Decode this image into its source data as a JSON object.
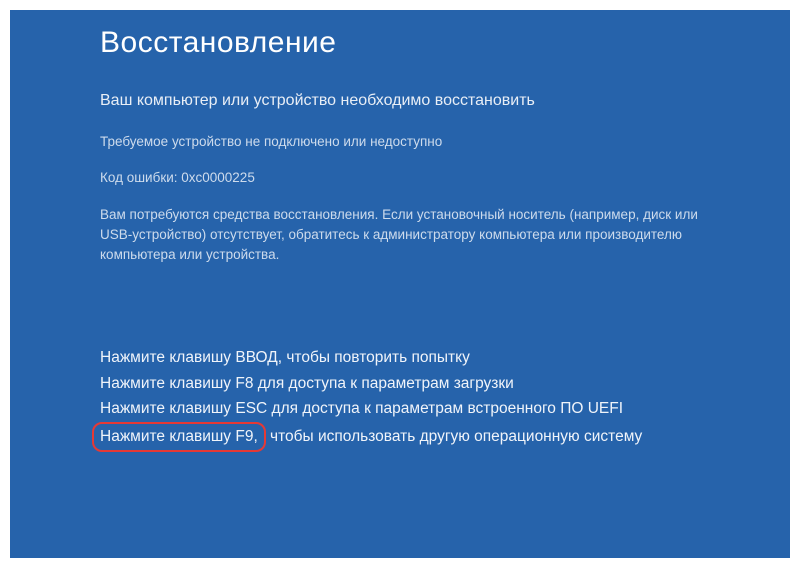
{
  "title": "Восстановление",
  "subtitle": "Ваш компьютер или устройство необходимо восстановить",
  "details": {
    "line1": "Требуемое устройство не подключено или недоступно",
    "line2": "Код ошибки: 0xc0000225",
    "line3": "Вам потребуются средства восстановления. Если установочный носитель (например, диск или USB-устройство) отсутствует, обратитесь к администратору компьютера или производителю компьютера или устройства."
  },
  "actions": {
    "enter": "Нажмите клавишу ВВОД, чтобы повторить попытку",
    "f8": "Нажмите клавишу F8 для доступа к параметрам загрузки",
    "esc": "Нажмите клавишу ESC для доступа к параметрам встроенного ПО UEFI",
    "f9_highlight": "Нажмите клавишу F9,",
    "f9_rest": " чтобы использовать другую операционную систему"
  }
}
